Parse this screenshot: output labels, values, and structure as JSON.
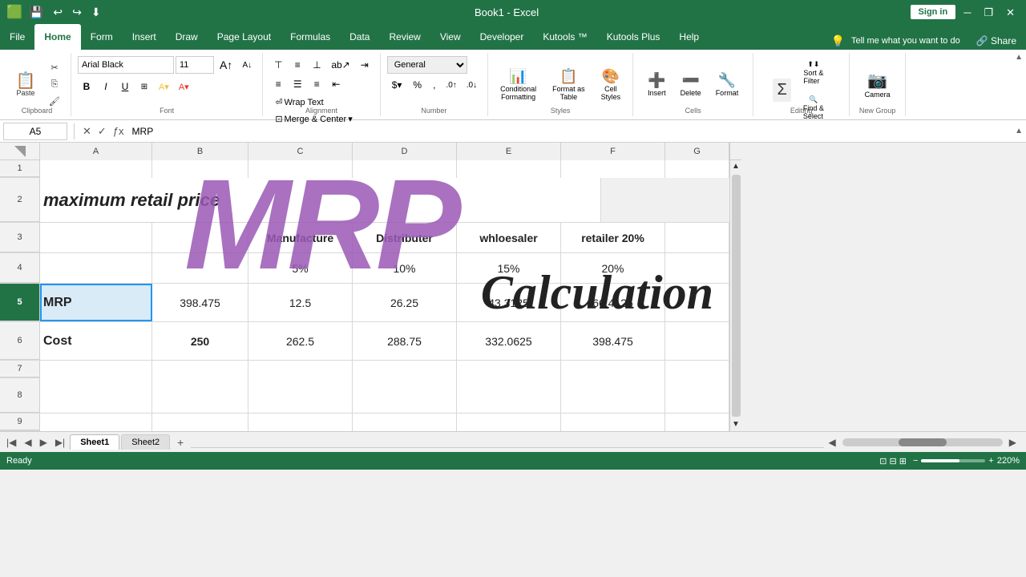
{
  "titlebar": {
    "title": "Book1 - Excel",
    "sign_in": "Sign in",
    "qat_icons": [
      "💾",
      "↩",
      "↪",
      "🔧",
      "⬇"
    ]
  },
  "ribbon": {
    "tabs": [
      "File",
      "Home",
      "Form",
      "Insert",
      "Draw",
      "Page Layout",
      "Formulas",
      "Data",
      "Review",
      "View",
      "Developer",
      "Kutools ™",
      "Kutools Plus",
      "Help"
    ],
    "active_tab": "Home",
    "help_placeholder": "Tell me what you want to do",
    "share_label": "Share",
    "font_name": "Arial Black",
    "font_size": "11",
    "wrap_text": "Wrap Text",
    "merge_center": "Merge & Center",
    "number_format": "General",
    "conditional": "Conditional\nFormatting",
    "format_as_table": "Format as\nTable",
    "cell_styles": "Cell\nStyles",
    "insert": "Insert",
    "delete": "Delete",
    "format": "Format",
    "sort_filter": "Sort &\nFilter",
    "find_select": "Find &\nSelect",
    "camera": "Camera",
    "sigma": "Σ",
    "groups": {
      "clipboard": "Clipboard",
      "font": "Font",
      "alignment": "Alignment",
      "number": "Number",
      "styles": "Styles",
      "cells": "Cells",
      "editing": "Editing",
      "new_group": "New Group"
    }
  },
  "formula_bar": {
    "name_box": "A5",
    "formula_content": "MRP"
  },
  "columns": {
    "headers": [
      "A",
      "B",
      "C",
      "D",
      "E",
      "F",
      "G"
    ],
    "col_classes": [
      "col-a",
      "col-b",
      "col-c",
      "col-d",
      "col-e",
      "col-f",
      "col-g"
    ]
  },
  "rows": [
    {
      "row_num": "1",
      "cells": [
        "",
        "",
        "",
        "",
        "",
        "",
        ""
      ]
    },
    {
      "row_num": "2",
      "cells": [
        "maximum retail price",
        "",
        "",
        "",
        "",
        "",
        ""
      ],
      "style": "large"
    },
    {
      "row_num": "3",
      "cells": [
        "",
        "",
        "Manufacture",
        "Distributer",
        "whloesaler",
        "retailer 20%",
        ""
      ]
    },
    {
      "row_num": "4",
      "cells": [
        "",
        "",
        "5%",
        "10%",
        "15%",
        "20%",
        ""
      ]
    },
    {
      "row_num": "5",
      "cells": [
        "MRP",
        "398.475",
        "12.5",
        "26.25",
        "43.3125",
        "66.4125",
        ""
      ],
      "bold": [
        0
      ]
    },
    {
      "row_num": "6",
      "cells": [
        "Cost",
        "250",
        "262.5",
        "288.75",
        "332.0625",
        "398.475",
        ""
      ],
      "bold": [
        0,
        1
      ]
    },
    {
      "row_num": "7",
      "cells": [
        "",
        "",
        "",
        "",
        "",
        "",
        ""
      ]
    },
    {
      "row_num": "8",
      "cells": [
        "",
        "",
        "",
        "",
        "",
        "",
        ""
      ]
    },
    {
      "row_num": "9",
      "cells": [
        "",
        "",
        "",
        "",
        "",
        "",
        ""
      ]
    }
  ],
  "mrp_overlay": {
    "text": "MRP",
    "calc_text": "Calculation"
  },
  "sheet_tabs": [
    "Sheet1",
    "Sheet2"
  ],
  "active_sheet": "Sheet1",
  "status": {
    "ready": "Ready",
    "zoom": "220%"
  }
}
